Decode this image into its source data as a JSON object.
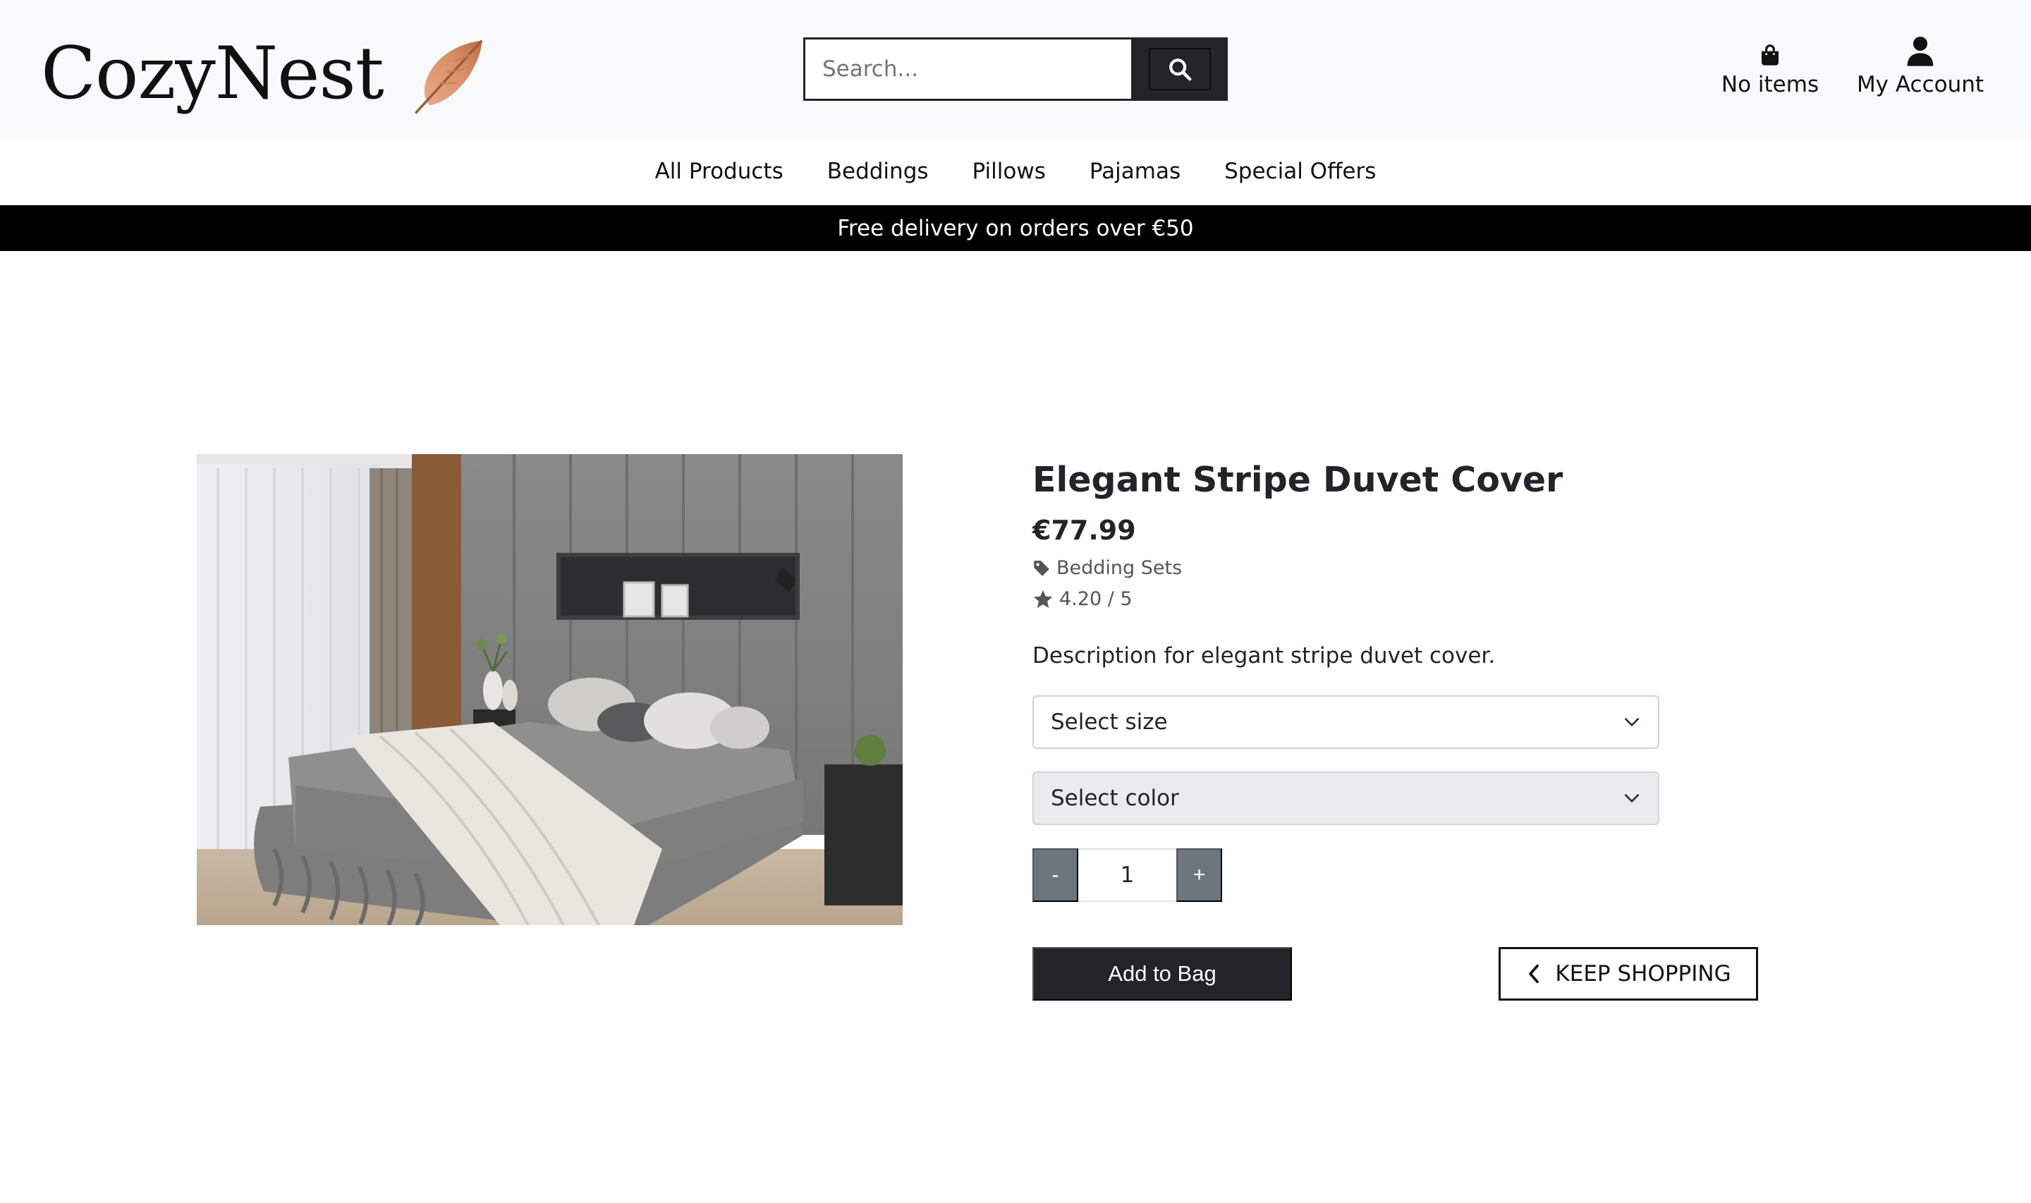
{
  "brand": {
    "name": "CozyNest",
    "logo_icon": "feather-icon"
  },
  "search": {
    "placeholder": "Search...",
    "button_icon": "search-icon"
  },
  "header_links": {
    "bag": {
      "label": "No items",
      "icon": "shopping-bag-icon"
    },
    "account": {
      "label": "My Account",
      "icon": "user-icon"
    }
  },
  "nav": {
    "items": [
      {
        "label": "All Products"
      },
      {
        "label": "Beddings"
      },
      {
        "label": "Pillows"
      },
      {
        "label": "Pajamas"
      },
      {
        "label": "Special Offers"
      }
    ]
  },
  "promo": {
    "text": "Free delivery on orders over €50"
  },
  "product": {
    "title": "Elegant Stripe Duvet Cover",
    "price": "€77.99",
    "category": "Bedding Sets",
    "rating": "4.20 / 5",
    "description": "Description for elegant stripe duvet cover.",
    "size_select": {
      "selected": "Select size"
    },
    "color_select": {
      "selected": "Select color"
    },
    "quantity": {
      "decrement": "-",
      "value": "1",
      "increment": "+"
    },
    "add_to_bag": "Add to Bag",
    "keep_shopping": "KEEP SHOPPING"
  },
  "colors": {
    "dark": "#212529",
    "promo_bg": "#000000",
    "header_bg": "#f8f9fa",
    "qty_btn": "#6c757d",
    "logo_feather": "#d9916a"
  }
}
